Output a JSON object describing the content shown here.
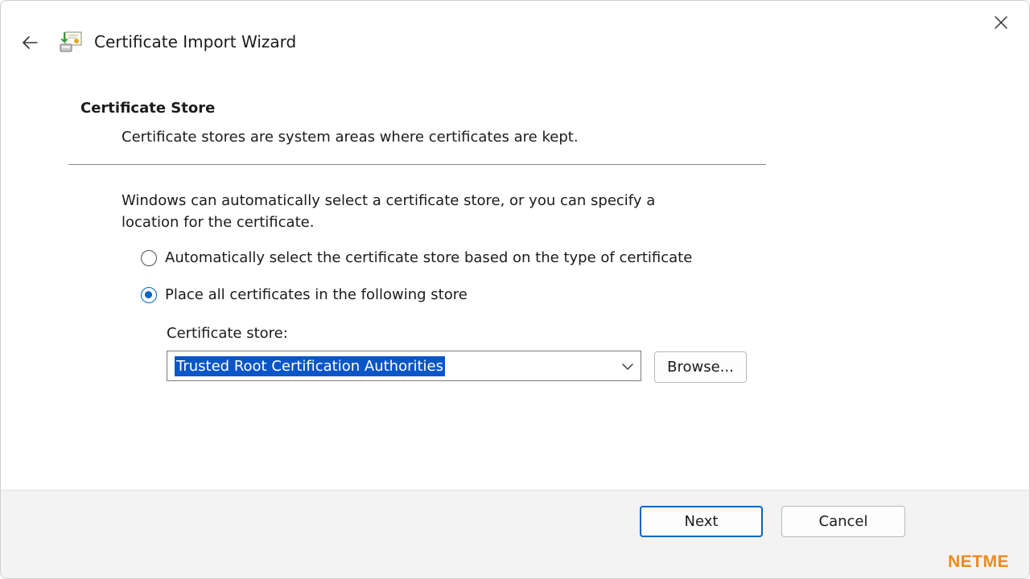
{
  "window": {
    "title": "Certificate Import Wizard",
    "title_icon": "certificate-import-icon",
    "back_icon": "arrow-left-icon",
    "close_icon": "close-icon"
  },
  "section": {
    "title": "Certificate Store",
    "subtitle": "Certificate stores are system areas where certificates are kept."
  },
  "description": "Windows can automatically select a certificate store, or you can specify a location for the certificate.",
  "options": [
    {
      "label": "Automatically select the certificate store based on the type of certificate",
      "selected": false
    },
    {
      "label": "Place all certificates in the following store",
      "selected": true
    }
  ],
  "store": {
    "label": "Certificate store:",
    "value": "Trusted Root Certification Authorities",
    "chevron_icon": "chevron-down-icon",
    "browse_label": "Browse..."
  },
  "footer": {
    "next_label": "Next",
    "cancel_label": "Cancel"
  },
  "watermark": {
    "text": "NETME",
    "color": "#f08a1c"
  },
  "colors": {
    "accent": "#0067c0",
    "selection": "#0a56c8",
    "footer_bg": "#f3f3f3"
  }
}
